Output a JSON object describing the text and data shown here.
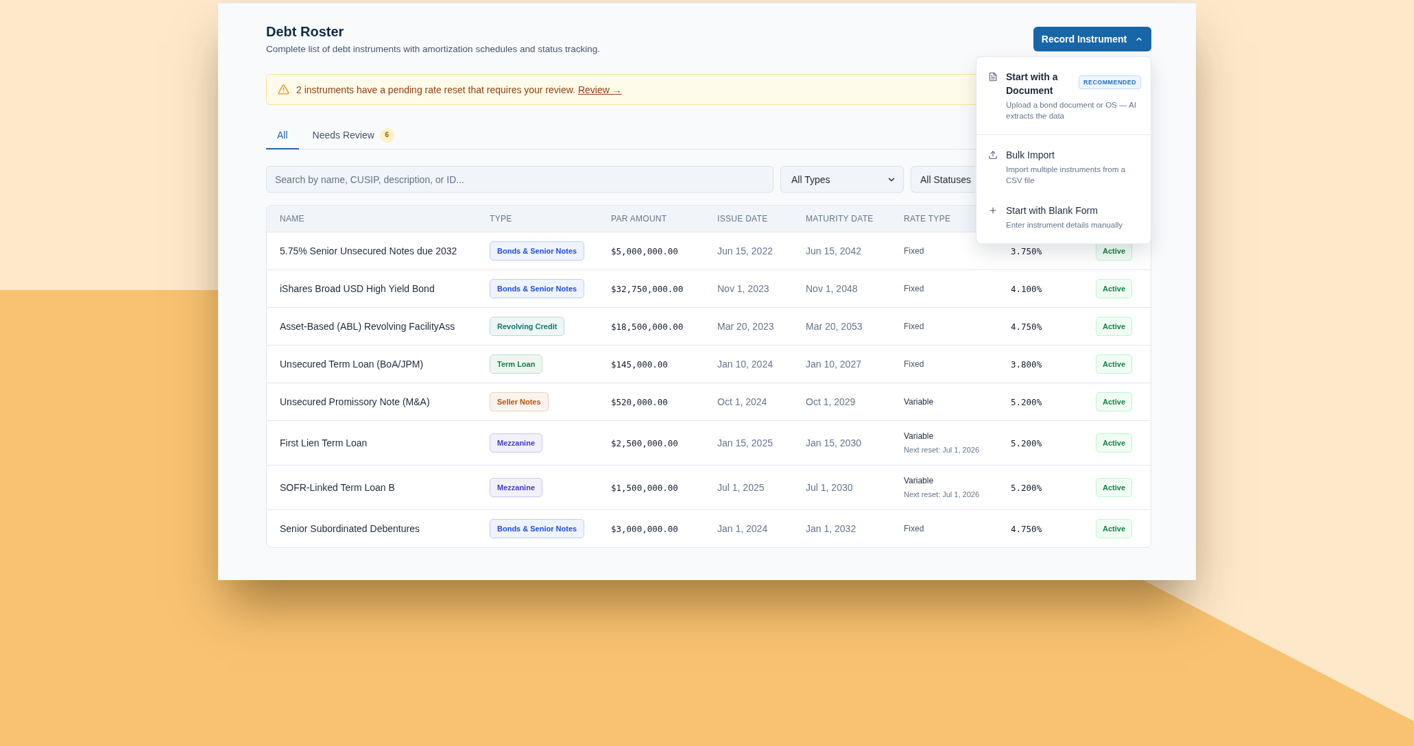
{
  "page": {
    "title": "Debt Roster",
    "subtitle": "Complete list of debt instruments with amortization schedules and status tracking."
  },
  "record_button": {
    "label": "Record Instrument",
    "expanded": true
  },
  "record_menu": {
    "sections": [
      {
        "items": [
          {
            "kind": "document",
            "title": "Start with a Document",
            "badge": "RECOMMENDED",
            "description": "Upload a bond document or OS — AI extracts the data"
          }
        ]
      },
      {
        "items": [
          {
            "kind": "import",
            "title": "Bulk Import",
            "description": "Import multiple instruments from a CSV file"
          },
          {
            "kind": "blank",
            "title": "Start with Blank Form",
            "description": "Enter instrument details manually"
          }
        ]
      }
    ]
  },
  "alert": {
    "message": "2 instruments have a pending rate reset that requires your review.",
    "link": "Review →"
  },
  "tabs": [
    {
      "label": "All",
      "selected": true
    },
    {
      "label": "Needs Review",
      "selected": false,
      "count": "6"
    }
  ],
  "filters": {
    "search": {
      "placeholder": "Search by name, CUSIP, description, or ID..."
    },
    "selects": [
      {
        "value": "All Types"
      },
      {
        "value": "All Statuses"
      }
    ]
  },
  "table": {
    "columns": [
      "NAME",
      "TYPE",
      "PAR AMOUNT",
      "ISSUE DATE",
      "MATURITY DATE",
      "RATE TYPE"
    ],
    "rows": [
      {
        "name": "5.75% Senior Unsecured Notes due 2032",
        "type": {
          "label": "Bonds & Senior Notes",
          "color": "#1d4ed8"
        },
        "par_amount": "$5,000,000.00",
        "issue_date": "Jun 15, 2022",
        "maturity_date": "Jun 15, 2042",
        "rate_type": {
          "label": "Fixed",
          "kind": "fixed"
        },
        "column_7": "3.750%",
        "column_8": "Active"
      },
      {
        "name": "iShares Broad USD High Yield Bond",
        "type": {
          "label": "Bonds & Senior Notes",
          "color": "#1d4ed8"
        },
        "par_amount": "$32,750,000.00",
        "issue_date": "Nov 1, 2023",
        "maturity_date": "Nov 1, 2048",
        "rate_type": {
          "label": "Fixed",
          "kind": "fixed"
        },
        "column_7": "4.100%",
        "column_8": "Active"
      },
      {
        "name": "Asset-Based (ABL) Revolving FacilityAss",
        "type": {
          "label": "Revolving Credit",
          "color": "#0f766e"
        },
        "par_amount": "$18,500,000.00",
        "issue_date": "Mar 20, 2023",
        "maturity_date": "Mar 20, 2053",
        "rate_type": {
          "label": "Fixed",
          "kind": "fixed"
        },
        "column_7": "4.750%",
        "column_8": "Active"
      },
      {
        "name": "Unsecured Term Loan (BoA/JPM)",
        "type": {
          "label": "Term Loan",
          "color": "#15803d"
        },
        "par_amount": "$145,000.00",
        "issue_date": "Jan 10, 2024",
        "maturity_date": "Jan 10, 2027",
        "rate_type": {
          "label": "Fixed",
          "kind": "fixed"
        },
        "column_7": "3.800%",
        "column_8": "Active"
      },
      {
        "name": "Unsecured Promissory Note (M&A)",
        "type": {
          "label": "Seller Notes",
          "color": "#b45309"
        },
        "par_amount": "$520,000.00",
        "issue_date": "Oct 1, 2024",
        "maturity_date": "Oct 1, 2029",
        "rate_type": {
          "label": "Variable",
          "kind": "variable"
        },
        "column_7": "5.200%",
        "column_8": "Active"
      },
      {
        "name": "First Lien Term Loan",
        "type": {
          "label": "Mezzanine",
          "color": "#4338ca"
        },
        "par_amount": "$2,500,000.00",
        "issue_date": "Jan 15, 2025",
        "maturity_date": "Jan 15, 2030",
        "rate_type": {
          "label": "Variable",
          "kind": "variable",
          "next_reset": "Next reset: Jul 1, 2026"
        },
        "column_7": "5.200%",
        "column_8": "Active"
      },
      {
        "name": "SOFR-Linked Term Loan B",
        "type": {
          "label": "Mezzanine",
          "color": "#4338ca"
        },
        "par_amount": "$1,500,000.00",
        "issue_date": "Jul 1, 2025",
        "maturity_date": "Jul 1, 2030",
        "rate_type": {
          "label": "Variable",
          "kind": "variable",
          "next_reset": "Next reset: Jul 1, 2026"
        },
        "column_7": "5.200%",
        "column_8": "Active"
      },
      {
        "name": "Senior Subordinated Debentures",
        "type": {
          "label": "Bonds & Senior Notes",
          "color": "#1d4ed8"
        },
        "par_amount": "$3,000,000.00",
        "issue_date": "Jan 1, 2024",
        "maturity_date": "Jan 1, 2032",
        "rate_type": {
          "label": "Fixed",
          "kind": "fixed"
        },
        "column_7": "4.750%",
        "column_8": "Active"
      }
    ]
  }
}
